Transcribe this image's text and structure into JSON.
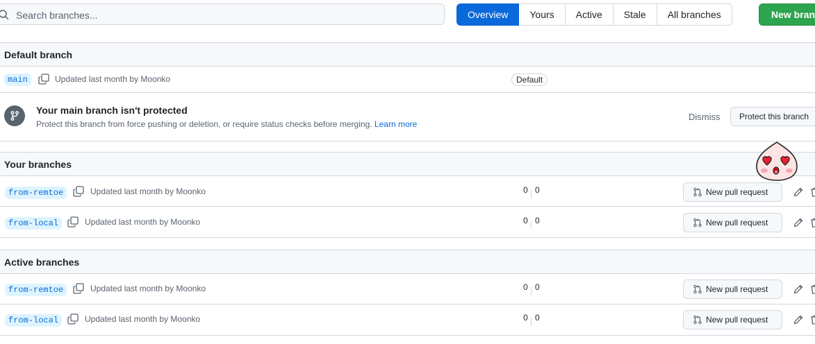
{
  "search": {
    "placeholder": "Search branches..."
  },
  "tabs": [
    {
      "label": "Overview"
    },
    {
      "label": "Yours"
    },
    {
      "label": "Active"
    },
    {
      "label": "Stale"
    },
    {
      "label": "All branches"
    }
  ],
  "new_branch_label": "New branch",
  "default_section": {
    "title": "Default branch",
    "branch": "main",
    "meta": "Updated last month by Moonko",
    "badge": "Default"
  },
  "notice": {
    "title": "Your main branch isn't protected",
    "description": "Protect this branch from force pushing or deletion, or require status checks before merging.",
    "learn_more": "Learn more",
    "dismiss": "Dismiss",
    "protect_label": "Protect this branch"
  },
  "your_section": {
    "title": "Your branches",
    "rows": [
      {
        "branch": "from-remtoe",
        "meta": "Updated last month by Moonko",
        "behind": "0",
        "ahead": "0",
        "pr_label": "New pull request"
      },
      {
        "branch": "from-local",
        "meta": "Updated last month by Moonko",
        "behind": "0",
        "ahead": "0",
        "pr_label": "New pull request"
      }
    ]
  },
  "active_section": {
    "title": "Active branches",
    "rows": [
      {
        "branch": "from-remtoe",
        "meta": "Updated last month by Moonko",
        "behind": "0",
        "ahead": "0",
        "pr_label": "New pull request"
      },
      {
        "branch": "from-local",
        "meta": "Updated last month by Moonko",
        "behind": "0",
        "ahead": "0",
        "pr_label": "New pull request"
      }
    ]
  },
  "colors": {
    "accent": "#0969da",
    "primary_button": "#2da44e",
    "branch_bg": "#ddf4ff",
    "border": "#d0d7de"
  }
}
